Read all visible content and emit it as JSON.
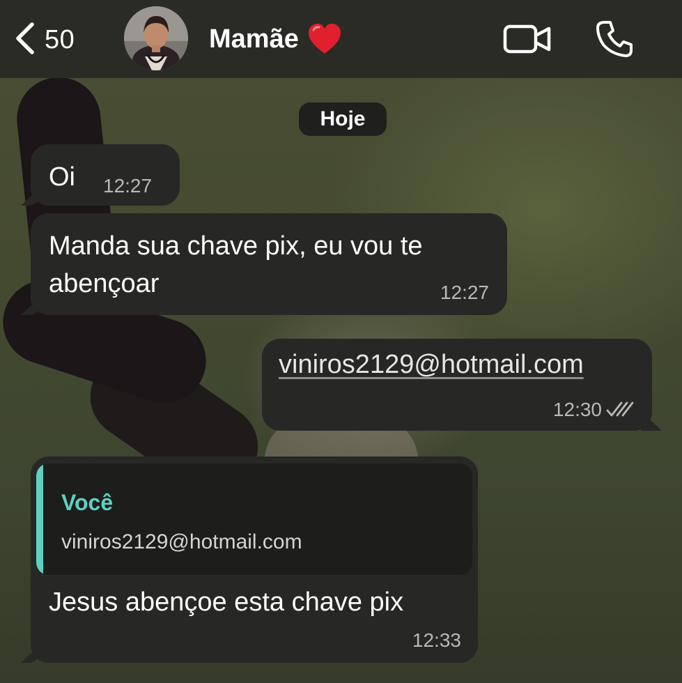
{
  "header": {
    "back_count": "50",
    "contact_name": "Mamãe",
    "contact_emoji_icon": "red-heart-icon",
    "icons": [
      "chevron-left-icon",
      "video-camera-icon",
      "phone-icon"
    ]
  },
  "chat": {
    "date_separator": "Hoje",
    "messages": [
      {
        "direction": "incoming",
        "text": "Oi",
        "time": "12:27"
      },
      {
        "direction": "incoming",
        "text": "Manda sua chave pix, eu vou te abençoar",
        "time": "12:27"
      },
      {
        "direction": "outgoing",
        "text": "viniros2129@hotmail.com",
        "time": "12:30",
        "status_icon": "double-check-icon"
      },
      {
        "direction": "incoming",
        "reply_to": {
          "author": "Você",
          "text": "viniros2129@hotmail.com"
        },
        "text": "Jesus abençoe esta chave pix",
        "time": "12:33"
      }
    ]
  },
  "colors": {
    "header_bg": "#2a2b25",
    "bubble_bg": "#272725",
    "quote_accent": "#5ed0c3",
    "heart": "#e0202e"
  }
}
